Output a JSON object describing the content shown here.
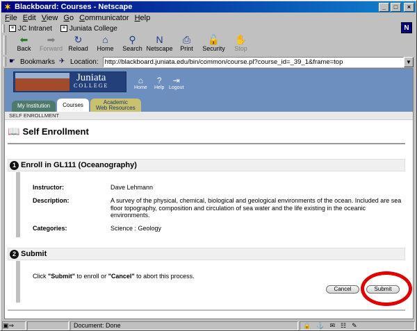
{
  "window": {
    "title": "Blackboard: Courses - Netscape",
    "controls": {
      "minimize": "_",
      "maximize": "□",
      "close": "×"
    }
  },
  "menu": [
    {
      "label": "File",
      "accel": "F"
    },
    {
      "label": "Edit",
      "accel": "E"
    },
    {
      "label": "View",
      "accel": "V"
    },
    {
      "label": "Go",
      "accel": "G"
    },
    {
      "label": "Communicator",
      "accel": "C"
    },
    {
      "label": "Help",
      "accel": "H"
    }
  ],
  "personal_toolbar": {
    "items": [
      "JC Intranet",
      "Juniata College"
    ],
    "logo": "N"
  },
  "nav_toolbar": {
    "buttons": [
      {
        "label": "Back",
        "icon": "back-arrow-icon",
        "glyph": "⬅",
        "color": "#2a7a2a",
        "enabled": true
      },
      {
        "label": "Forward",
        "icon": "forward-arrow-icon",
        "glyph": "➡",
        "color": "#808080",
        "enabled": false
      },
      {
        "label": "Reload",
        "icon": "reload-icon",
        "glyph": "↻",
        "color": "#1a3a8a",
        "enabled": true
      },
      {
        "label": "Home",
        "icon": "home-icon",
        "glyph": "⌂",
        "color": "#1a3a8a",
        "enabled": true
      },
      {
        "label": "Search",
        "icon": "search-icon",
        "glyph": "⚲",
        "color": "#1a3a8a",
        "enabled": true
      },
      {
        "label": "Netscape",
        "icon": "netscape-icon",
        "glyph": "N",
        "color": "#1a3a8a",
        "enabled": true
      },
      {
        "label": "Print",
        "icon": "print-icon",
        "glyph": "⎙",
        "color": "#1a3a8a",
        "enabled": true
      },
      {
        "label": "Security",
        "icon": "security-lock-icon",
        "glyph": "🔓",
        "color": "#8a6a1a",
        "enabled": true
      },
      {
        "label": "Stop",
        "icon": "stop-icon",
        "glyph": "✋",
        "color": "#808080",
        "enabled": false
      }
    ]
  },
  "location_bar": {
    "bookmarks_label": "Bookmarks",
    "location_label": "Location:",
    "url": "http://blackboard.juniata.edu/bin/common/course.pl?course_id=_39_1&frame=top"
  },
  "bb_header": {
    "logo_line1": "Juniata",
    "logo_line2": "COLLEGE",
    "nav": [
      {
        "label": "Home",
        "icon": "home-icon",
        "glyph": "⌂"
      },
      {
        "label": "Help",
        "icon": "help-icon",
        "glyph": "?"
      },
      {
        "label": "Logout",
        "icon": "logout-icon",
        "glyph": "⇥"
      }
    ],
    "tabs": {
      "my_institution": "My Institution",
      "courses": "Courses",
      "academic_line1": "Academic",
      "academic_line2": "Web Resources"
    }
  },
  "breadcrumb": "SELF ENROLLMENT",
  "page": {
    "title": "Self Enrollment",
    "section1": {
      "num": "1",
      "title": "Enroll in GL111 (Oceanography)",
      "instructor_label": "Instructor:",
      "instructor": "Dave Lehmann",
      "description_label": "Description:",
      "description": "A survey of the physical, chemical, biological and geological environments of the ocean. Included are sea floor topography, composition and circulation of sea water and the life existing in the oceanic environments.",
      "categories_label": "Categories:",
      "categories": "Science : Geology"
    },
    "section2": {
      "num": "2",
      "title": "Submit",
      "text_before": "Click ",
      "submit_word": "\"Submit\"",
      "text_middle": " to enroll or ",
      "cancel_word": "\"Cancel\"",
      "text_after": " to abort this process."
    },
    "buttons": {
      "cancel": "Cancel",
      "submit": "Submit"
    }
  },
  "status": {
    "text": "Document: Done"
  }
}
